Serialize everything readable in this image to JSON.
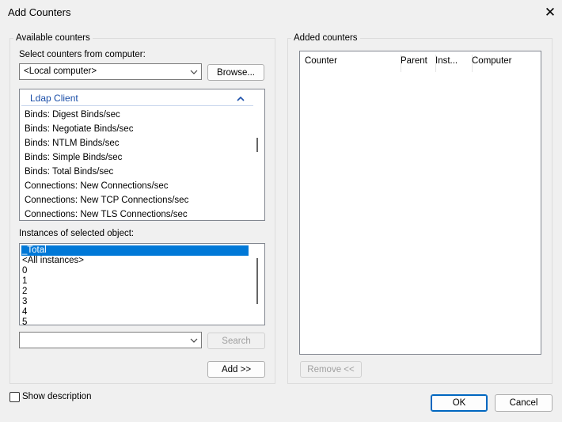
{
  "window": {
    "title": "Add Counters",
    "close_glyph": "✕"
  },
  "available": {
    "group_label": "Available counters",
    "computer_label": "Select counters from computer:",
    "computer_value": "<Local computer>",
    "browse_label": "Browse...",
    "object_name": "Ldap Client",
    "counters": [
      "Binds: Digest Binds/sec",
      "Binds: Negotiate Binds/sec",
      "Binds: NTLM Binds/sec",
      "Binds: Simple Binds/sec",
      "Binds: Total Binds/sec",
      "Connections: New Connections/sec",
      "Connections: New TCP Connections/sec",
      "Connections: New TLS Connections/sec"
    ],
    "instances_label": "Instances of selected object:",
    "instances": [
      "_Total",
      "<All instances>",
      "0",
      "1",
      "2",
      "3",
      "4",
      "5"
    ],
    "selected_instance": "_Total",
    "search_value": "",
    "search_label": "Search",
    "add_label": "Add >>"
  },
  "added": {
    "group_label": "Added counters",
    "columns": [
      "Counter",
      "Parent",
      "Inst...",
      "Computer"
    ],
    "rows": [],
    "remove_label": "Remove <<"
  },
  "footer": {
    "show_description_label": "Show description",
    "show_description_checked": false,
    "ok_label": "OK",
    "cancel_label": "Cancel"
  }
}
